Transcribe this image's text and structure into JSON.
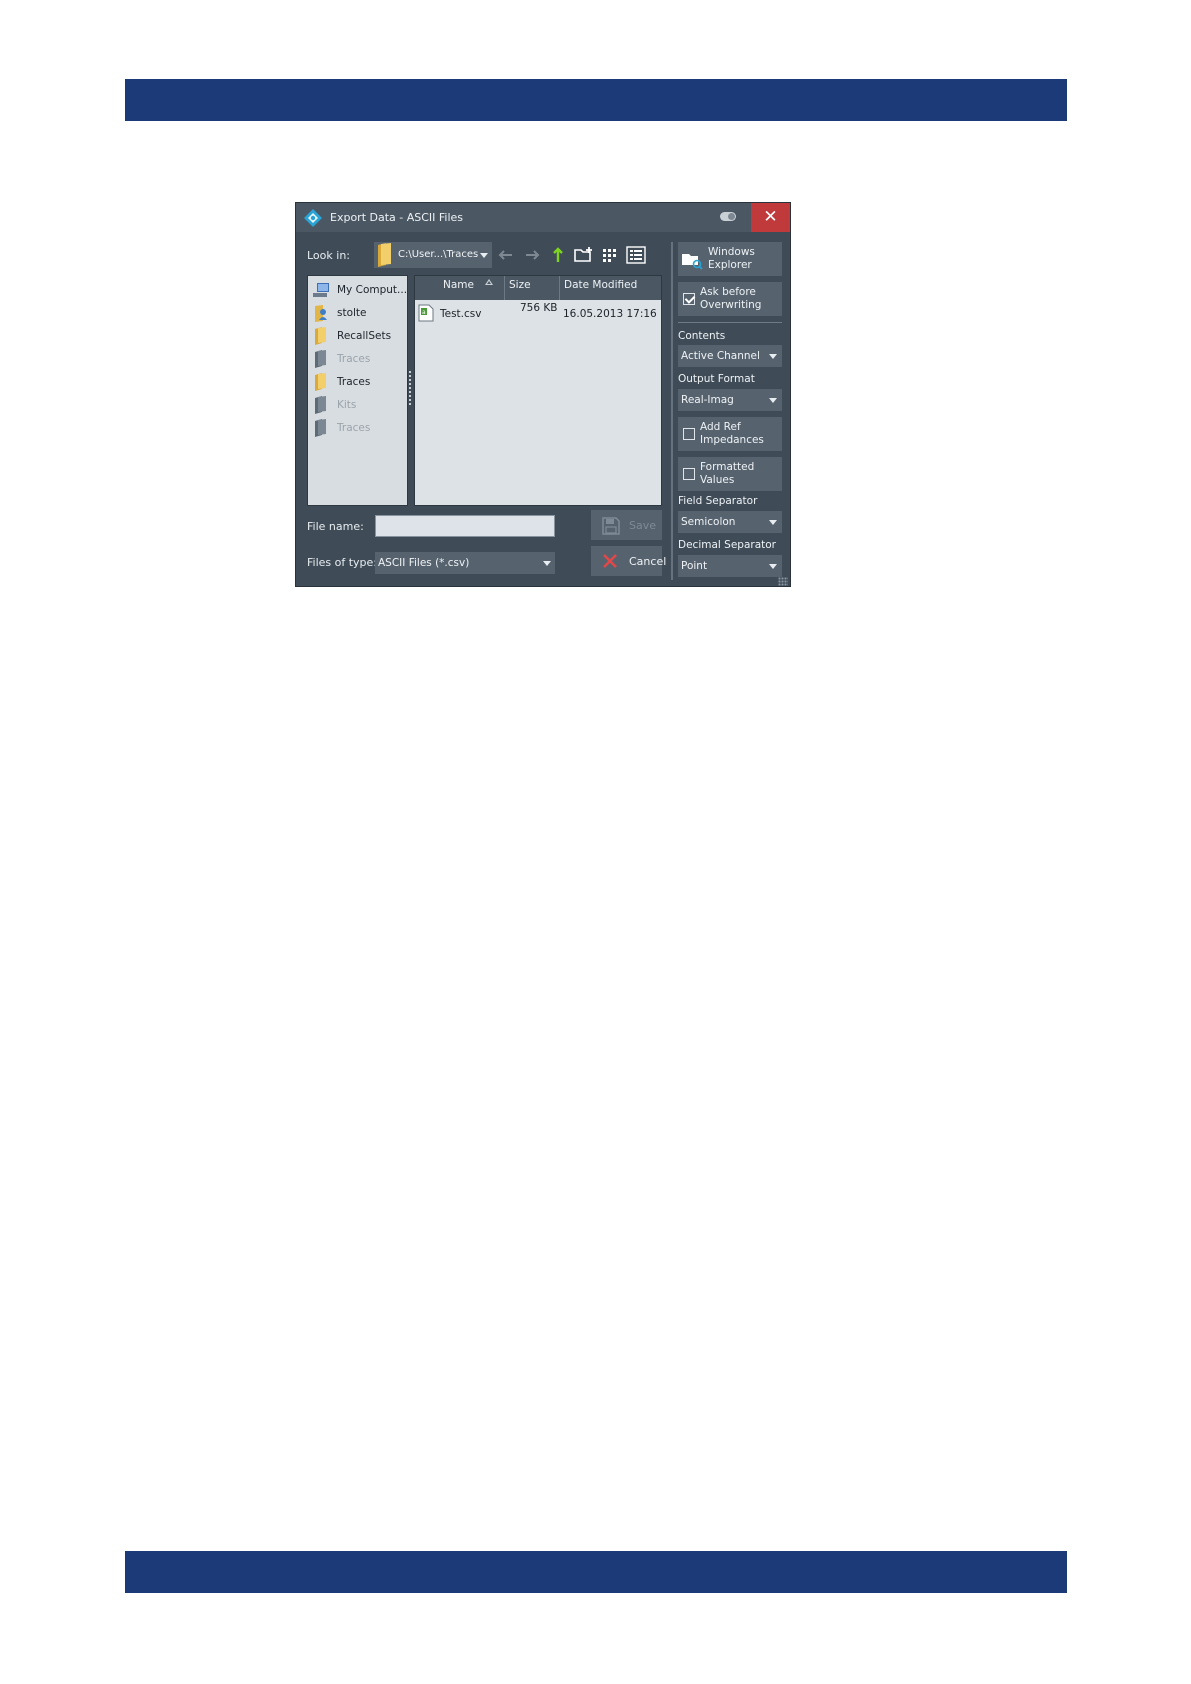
{
  "dialog": {
    "title": "Export Data - ASCII Files",
    "close_glyph": "✕",
    "look_in_label": "Look in:",
    "look_in_path": "C:\\User...\\Traces",
    "places": [
      {
        "label": "My Comput...",
        "icon": "computer-icon",
        "enabled": true
      },
      {
        "label": "stolte",
        "icon": "user-folder-icon",
        "enabled": true
      },
      {
        "label": "RecallSets",
        "icon": "folder-icon",
        "enabled": true
      },
      {
        "label": "Traces",
        "icon": "folder-icon",
        "enabled": false
      },
      {
        "label": "Traces",
        "icon": "folder-icon",
        "enabled": true
      },
      {
        "label": "Kits",
        "icon": "folder-icon",
        "enabled": false
      },
      {
        "label": "Traces",
        "icon": "folder-icon",
        "enabled": false
      }
    ],
    "columns": {
      "name": "Name",
      "size": "Size",
      "date": "Date Modified"
    },
    "files": [
      {
        "name": "Test.csv",
        "size": "756 KB",
        "date": "16.05.2013 17:16",
        "icon": "csv-file-icon"
      }
    ],
    "file_name_label": "File name:",
    "file_name_value": "",
    "files_of_type_label": "Files of type:",
    "files_of_type_value": "ASCII Files (*.csv)",
    "save_label": "Save",
    "cancel_label": "Cancel",
    "side": {
      "windows_explorer": [
        "Windows",
        "Explorer"
      ],
      "ask_before": [
        "Ask before",
        "Overwriting"
      ],
      "ask_before_checked": true,
      "contents_label": "Contents",
      "contents_value": "Active Channel",
      "output_format_label": "Output Format",
      "output_format_value": "Real-Imag",
      "add_ref": [
        "Add Ref",
        "Impedances"
      ],
      "add_ref_checked": false,
      "formatted": [
        "Formatted",
        "Values"
      ],
      "formatted_checked": false,
      "field_sep_label": "Field Separator",
      "field_sep_value": "Semicolon",
      "decimal_sep_label": "Decimal Separator",
      "decimal_sep_value": "Point"
    }
  },
  "colors": {
    "header_band": "#1c3a77",
    "dialog_bg": "#3f4c58",
    "close_red": "#c0393b",
    "up_arrow": "#7ed321"
  }
}
